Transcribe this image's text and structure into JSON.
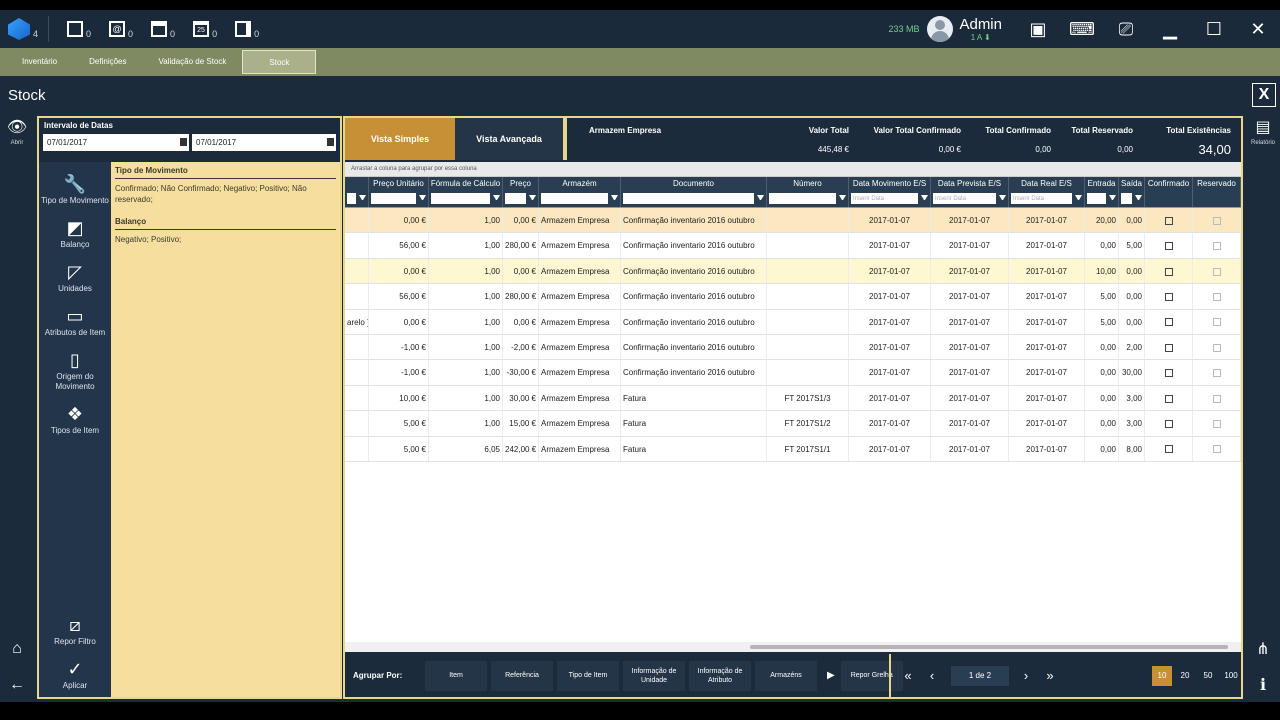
{
  "topbar": {
    "app_count": "4",
    "icons": [
      {
        "name": "document-icon",
        "count": "0"
      },
      {
        "name": "email-icon",
        "count": "0"
      },
      {
        "name": "note-icon",
        "count": "0"
      },
      {
        "name": "calendar-icon",
        "count": "0",
        "label": "25"
      },
      {
        "name": "chat-icon",
        "count": "0"
      }
    ],
    "memory": "233 MB",
    "user_name": "Admin",
    "user_sub": "1 A ⬇"
  },
  "tabs": [
    "Inventário",
    "Definições",
    "Validação de Stock",
    "Stock"
  ],
  "page_title": "Stock",
  "close_label": "X",
  "left_rail": {
    "view_label": "Abrir"
  },
  "right_rail": {
    "report_label": "Relatório"
  },
  "date_filter": {
    "label": "Intervalo de Datas",
    "from": "07/01/2017",
    "to": "07/01/2017"
  },
  "categories": [
    {
      "icon": "wrench-icon",
      "label": "Tipo de Movimento"
    },
    {
      "icon": "balance-icon",
      "label": "Balanço"
    },
    {
      "icon": "ruler-icon",
      "label": "Unidades"
    },
    {
      "icon": "tag-icon",
      "label": "Atributos de Item"
    },
    {
      "icon": "origin-icon",
      "label": "Origem do Movimento"
    },
    {
      "icon": "item-types-icon",
      "label": "Tipos de Item"
    }
  ],
  "bottom_actions": {
    "reset_label": "Repor Filtro",
    "apply_label": "Aplicar"
  },
  "criteria": {
    "mov_title": "Tipo de Movimento",
    "mov_text": "Confirmado; Não Confirmado; Negativo; Positivo; Não reservado;",
    "bal_title": "Balanço",
    "bal_text": "Negativo; Positivo;"
  },
  "views": {
    "simple": "Vista Simples",
    "advanced": "Vista Avançada"
  },
  "summary": {
    "warehouse": "Armazem Empresa",
    "valor_total_label": "Valor Total",
    "valor_total": "445,48 €",
    "valor_conf_label": "Valor Total Confirmado",
    "valor_conf": "0,00 €",
    "total_conf_label": "Total Confirmado",
    "total_conf": "0,00",
    "total_res_label": "Total Reservado",
    "total_res": "0,00",
    "total_exist_label": "Total Existências",
    "total_exist": "34,00"
  },
  "grid": {
    "drag_hint": "Arrastar a coluna para agrupar por essa coluna",
    "columns": [
      "",
      "Preço Unitário",
      "Fórmula de Cálculo",
      "Preço",
      "Armazém",
      "Documento",
      "Número",
      "Data Movimento E/S",
      "Data Prevista E/S",
      "Data Real E/S",
      "Entrada",
      "Saída",
      "Confirmado",
      "Reservado"
    ],
    "date_placeholder": "Inserir Data",
    "rows": [
      {
        "c0": "",
        "unit": "0,00 €",
        "formula": "1,00",
        "price": "0,00 €",
        "wh": "Armazem Empresa",
        "doc": "Confirmação inventario 2016 outubro",
        "num": "",
        "dm": "2017-01-07",
        "dp": "2017-01-07",
        "dr": "2017-01-07",
        "in": "20,00",
        "out": "0,00"
      },
      {
        "c0": "",
        "unit": "56,00 €",
        "formula": "1,00",
        "price": "280,00 €",
        "wh": "Armazem Empresa",
        "doc": "Confirmação inventario 2016 outubro",
        "num": "",
        "dm": "2017-01-07",
        "dp": "2017-01-07",
        "dr": "2017-01-07",
        "in": "0,00",
        "out": "5,00"
      },
      {
        "c0": "",
        "unit": "0,00 €",
        "formula": "1,00",
        "price": "0,00 €",
        "wh": "Armazem Empresa",
        "doc": "Confirmação inventario 2016 outubro",
        "num": "",
        "dm": "2017-01-07",
        "dp": "2017-01-07",
        "dr": "2017-01-07",
        "in": "10,00",
        "out": "0,00"
      },
      {
        "c0": "",
        "unit": "56,00 €",
        "formula": "1,00",
        "price": "280,00 €",
        "wh": "Armazem Empresa",
        "doc": "Confirmação inventario 2016 outubro",
        "num": "",
        "dm": "2017-01-07",
        "dp": "2017-01-07",
        "dr": "2017-01-07",
        "in": "5,00",
        "out": "0,00"
      },
      {
        "c0": "arelo ]",
        "unit": "0,00 €",
        "formula": "1,00",
        "price": "0,00 €",
        "wh": "Armazem Empresa",
        "doc": "Confirmação inventario 2016 outubro",
        "num": "",
        "dm": "2017-01-07",
        "dp": "2017-01-07",
        "dr": "2017-01-07",
        "in": "5,00",
        "out": "0,00"
      },
      {
        "c0": "",
        "unit": "-1,00 €",
        "formula": "1,00",
        "price": "-2,00 €",
        "wh": "Armazem Empresa",
        "doc": "Confirmação inventario 2016 outubro",
        "num": "",
        "dm": "2017-01-07",
        "dp": "2017-01-07",
        "dr": "2017-01-07",
        "in": "0,00",
        "out": "2,00"
      },
      {
        "c0": "",
        "unit": "-1,00 €",
        "formula": "1,00",
        "price": "-30,00 €",
        "wh": "Armazem Empresa",
        "doc": "Confirmação inventario 2016 outubro",
        "num": "",
        "dm": "2017-01-07",
        "dp": "2017-01-07",
        "dr": "2017-01-07",
        "in": "0,00",
        "out": "30,00"
      },
      {
        "c0": "",
        "unit": "10,00 €",
        "formula": "1,00",
        "price": "30,00 €",
        "wh": "Armazem Empresa",
        "doc": "Fatura",
        "num": "FT 2017S1/3",
        "dm": "2017-01-07",
        "dp": "2017-01-07",
        "dr": "2017-01-07",
        "in": "0,00",
        "out": "3,00"
      },
      {
        "c0": "",
        "unit": "5,00 €",
        "formula": "1,00",
        "price": "15,00 €",
        "wh": "Armazem Empresa",
        "doc": "Fatura",
        "num": "FT 2017S1/2",
        "dm": "2017-01-07",
        "dp": "2017-01-07",
        "dr": "2017-01-07",
        "in": "0,00",
        "out": "3,00"
      },
      {
        "c0": "",
        "unit": "5,00 €",
        "formula": "6,05",
        "price": "242,00 €",
        "wh": "Armazem Empresa",
        "doc": "Fatura",
        "num": "FT 2017S1/1",
        "dm": "2017-01-07",
        "dp": "2017-01-07",
        "dr": "2017-01-07",
        "in": "0,00",
        "out": "8,00"
      }
    ]
  },
  "footer": {
    "group_label": "Agrupar Por:",
    "groups": [
      "Item",
      "Referência",
      "Tipo de Item",
      "Informação de Unidade",
      "Informação de Atributo",
      "Armazéns"
    ],
    "reset_grid": "Repor Grelha",
    "page_info": "1 de 2",
    "page_sizes": [
      "10",
      "20",
      "50",
      "100"
    ]
  }
}
